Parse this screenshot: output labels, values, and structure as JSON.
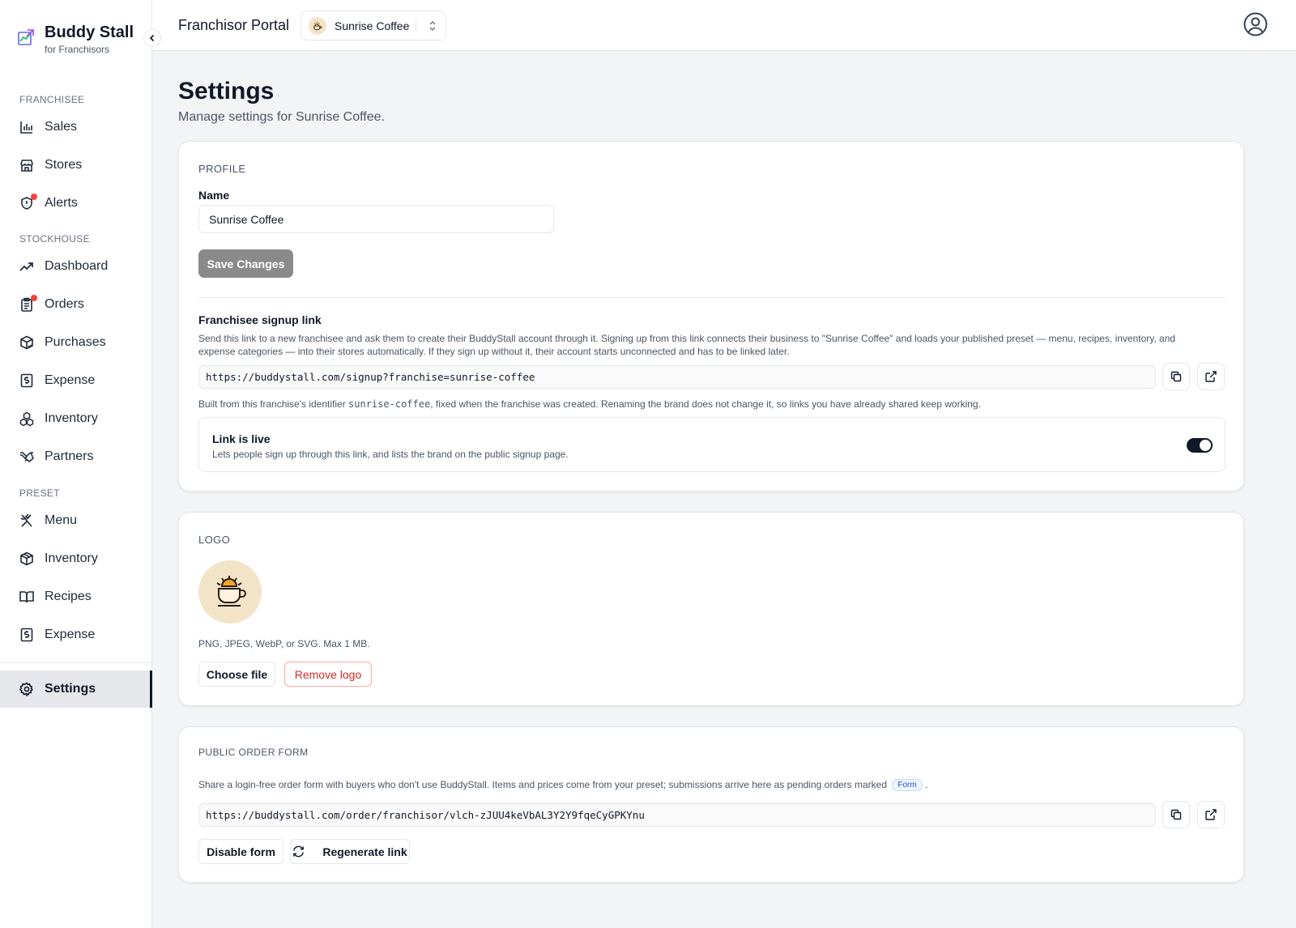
{
  "brand": {
    "name": "Buddy Stall",
    "subtitle": "for Franchisors"
  },
  "sidebar": {
    "sections": [
      {
        "label": "FRANCHISEE",
        "items": [
          {
            "label": "Sales",
            "icon": "bar-chart-icon"
          },
          {
            "label": "Stores",
            "icon": "store-icon"
          },
          {
            "label": "Alerts",
            "icon": "alert-icon",
            "badge_dot": true
          }
        ]
      },
      {
        "label": "STOCKHOUSE",
        "items": [
          {
            "label": "Dashboard",
            "icon": "trending-up-icon"
          },
          {
            "label": "Orders",
            "icon": "clipboard-icon",
            "badge_dot": true
          },
          {
            "label": "Purchases",
            "icon": "package-check-icon"
          },
          {
            "label": "Expense",
            "icon": "receipt-dollar-icon"
          },
          {
            "label": "Inventory",
            "icon": "boxes-icon"
          },
          {
            "label": "Partners",
            "icon": "handshake-icon"
          }
        ]
      },
      {
        "label": "PRESET",
        "items": [
          {
            "label": "Menu",
            "icon": "utensils-crossed-icon"
          },
          {
            "label": "Inventory",
            "icon": "box-icon"
          },
          {
            "label": "Recipes",
            "icon": "book-open-icon"
          },
          {
            "label": "Expense",
            "icon": "receipt-dollar-icon"
          }
        ]
      }
    ],
    "settings_label": "Settings",
    "accent_dot_color": "#ef4444"
  },
  "topbar": {
    "portal_title": "Franchisor Portal",
    "selected_brand": "Sunrise Coffee"
  },
  "page": {
    "title": "Settings",
    "subtitle": "Manage settings for Sunrise Coffee."
  },
  "profile": {
    "section_label": "PROFILE",
    "name_label": "Name",
    "name_value": "Sunrise Coffee",
    "save_label": "Save Changes",
    "signup_title": "Franchisee signup link",
    "signup_help": "Send this link to a new franchisee and ask them to create their BuddyStall account through it. Signing up from this link connects their business to \"Sunrise Coffee\" and loads your published preset — menu, recipes, inventory, and expense categories — into their stores automatically. If they sign up without it, their account starts unconnected and has to be linked later.",
    "signup_url": "https://buddystall.com/signup?franchise=sunrise-coffee",
    "identifier_note_pre": "Built from this franchise's identifier ",
    "identifier": "sunrise-coffee",
    "identifier_note_post": ", fixed when the franchise was created. Renaming the brand does not change it, so links you have already shared keep working.",
    "live_title": "Link is live",
    "live_desc": "Lets people sign up through this link, and lists the brand on the public signup page.",
    "live_enabled": true
  },
  "logo": {
    "section_label": "LOGO",
    "formats_note": "PNG, JPEG, WebP, or SVG. Max 1 MB.",
    "choose_label": "Choose file",
    "remove_label": "Remove logo",
    "logo_bg_color": "#f3e4c8",
    "logo_accent_color": "#f5a524"
  },
  "order_form": {
    "section_label": "PUBLIC ORDER FORM",
    "help_text": "Share a login-free order form with buyers who don't use BuddyStall. Items and prices come from your preset; submissions arrive here as pending orders marked",
    "badge": "Form",
    "help_suffix": ".",
    "url": "https://buddystall.com/order/franchisor/vlch-zJUU4keVbAL3Y2Y9fqeCyGPKYnu",
    "disable_label": "Disable form",
    "regenerate_label": "Regenerate link"
  }
}
